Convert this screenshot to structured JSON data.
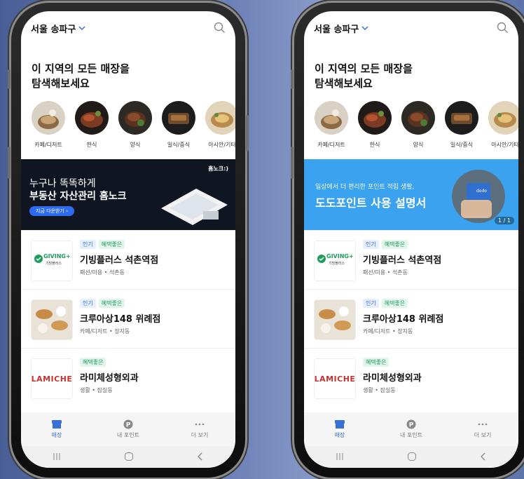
{
  "screens": [
    {
      "location": "서울 송파구",
      "headline_line1": "이 지역의 모든 매장을",
      "headline_line2": "탐색해보세요",
      "categories": [
        "카페/디저트",
        "한식",
        "양식",
        "일식/중식",
        "아시안/기타"
      ],
      "banner": {
        "brand": "홈노크:)",
        "line1": "누구나 똑똑하게",
        "line2": "부동산 자산관리 홈노크",
        "button": "지금 다운받기 ›"
      },
      "stores": [
        {
          "logo_text": "GIVING+",
          "logo_sub": "기빙플러스",
          "badges": [
            "인기",
            "혜택좋은"
          ],
          "name": "기빙플러스 석촌역점",
          "meta": "패션/미용 • 석촌동"
        },
        {
          "logo_text": "",
          "logo_sub": "",
          "badges": [
            "인기",
            "혜택좋은"
          ],
          "name": "크루아상148 위례점",
          "meta": "카페/디저트 • 장지동"
        },
        {
          "logo_text": "LAMICHE",
          "logo_sub": "",
          "badges": [
            "혜택좋은"
          ],
          "name": "라미체성형외과",
          "meta": "생활 • 잠실동"
        }
      ],
      "tabs": [
        "매장",
        "내 포인트",
        "더 보기"
      ]
    },
    {
      "location": "서울 송파구",
      "headline_line1": "이 지역의 모든 매장을",
      "headline_line2": "탐색해보세요",
      "categories": [
        "카페/디저트",
        "한식",
        "양식",
        "일식/중식",
        "아시안/기타"
      ],
      "banner": {
        "subtitle": "일상에서 더 편리한 포인트 적립 생활,",
        "title": "도도포인트 사용 설명서",
        "card_text": "dodo",
        "counter": "1 / 1"
      },
      "stores": [
        {
          "logo_text": "GIVING+",
          "logo_sub": "기빙플러스",
          "badges": [
            "인기",
            "혜택좋은"
          ],
          "name": "기빙플러스 석촌역점",
          "meta": "패션/미용 • 석촌동"
        },
        {
          "logo_text": "",
          "logo_sub": "",
          "badges": [
            "인기",
            "혜택좋은"
          ],
          "name": "크루아상148 위례점",
          "meta": "카페/디저트 • 장지동"
        },
        {
          "logo_text": "LAMICHE",
          "logo_sub": "",
          "badges": [
            "혜택좋은"
          ],
          "name": "라미체성형외과",
          "meta": "생활 • 잠실동"
        }
      ],
      "tabs": [
        "매장",
        "내 포인트",
        "더 보기"
      ]
    }
  ],
  "colors": {
    "accent": "#3a6fd8",
    "benefit": "#1f9d5c",
    "banner_blue": "#3aa2ee",
    "banner_dark": "#101522"
  },
  "icons": {
    "nav": [
      "recent-apps-icon",
      "home-icon",
      "back-icon"
    ]
  }
}
